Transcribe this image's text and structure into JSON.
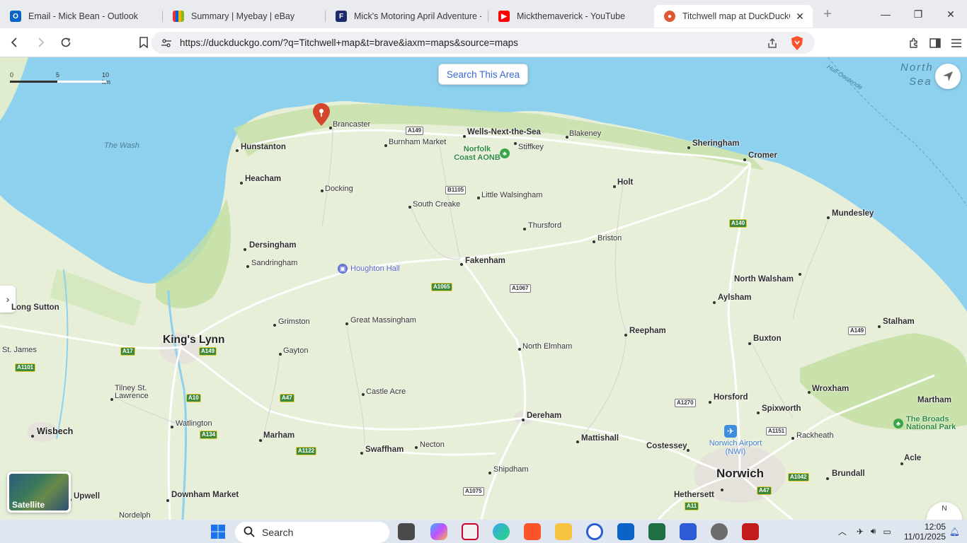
{
  "browser": {
    "tabs": [
      {
        "title": "Email - Mick Bean - Outlook",
        "icon": "outlook-icon",
        "color": "#0a64c8"
      },
      {
        "title": "Summary | Myebay | eBay",
        "icon": "ebay-icon",
        "color": "#e53238"
      },
      {
        "title": "Mick's Motoring April Adventure - ",
        "icon": "fc-icon",
        "color": "#1d2a6b"
      },
      {
        "title": "Mickthemaverick - YouTube",
        "icon": "youtube-icon",
        "color": "#ff0000"
      },
      {
        "title": "Titchwell map at DuckDuckGo",
        "icon": "duckduckgo-icon",
        "color": "#de5833",
        "active": true
      }
    ],
    "new_tab_label": "+",
    "url": "https://duckduckgo.com/?q=Titchwell+map&t=brave&iaxm=maps&source=maps"
  },
  "map": {
    "search_this_area": "Search This Area",
    "scale": {
      "zero": "0",
      "mid": "5",
      "end": "10 km"
    },
    "satellite_label": "Satellite",
    "compass_label": "N",
    "sea_labels": [
      {
        "text": "The Wash"
      },
      {
        "text": "North"
      },
      {
        "text": "Sea"
      },
      {
        "text": "Hull-Oostende"
      }
    ],
    "places": [
      {
        "text": "Brancaster",
        "size": "sm"
      },
      {
        "text": "Hunstanton",
        "size": "med"
      },
      {
        "text": "Burnham Market",
        "size": "sm"
      },
      {
        "text": "Wells-Next-the-Sea",
        "size": "med"
      },
      {
        "text": "Blakeney",
        "size": "sm"
      },
      {
        "text": "Stiffkey",
        "size": "sm"
      },
      {
        "text": "Sheringham",
        "size": "med"
      },
      {
        "text": "Cromer",
        "size": "med"
      },
      {
        "text": "Heacham",
        "size": "med"
      },
      {
        "text": "Docking",
        "size": "sm"
      },
      {
        "text": "Little Walsingham",
        "size": "sm"
      },
      {
        "text": "South Creake",
        "size": "sm"
      },
      {
        "text": "Holt",
        "size": "med"
      },
      {
        "text": "Mundesley",
        "size": "med"
      },
      {
        "text": "Thursford",
        "size": "sm"
      },
      {
        "text": "Briston",
        "size": "sm"
      },
      {
        "text": "Dersingham",
        "size": "med"
      },
      {
        "text": "Sandringham",
        "size": "sm"
      },
      {
        "text": "Fakenham",
        "size": "med"
      },
      {
        "text": "North Walsham",
        "size": "med"
      },
      {
        "text": "Aylsham",
        "size": "med"
      },
      {
        "text": "Long Sutton",
        "size": "med"
      },
      {
        "text": "Grimston",
        "size": "sm"
      },
      {
        "text": "Great Massingham",
        "size": "sm"
      },
      {
        "text": "Reepham",
        "size": "med"
      },
      {
        "text": "Stalham",
        "size": "med"
      },
      {
        "text": "King's Lynn",
        "size": "xl"
      },
      {
        "text": "St. James",
        "size": "sm"
      },
      {
        "text": "Gayton",
        "size": "sm"
      },
      {
        "text": "North Elmham",
        "size": "sm"
      },
      {
        "text": "Buxton",
        "size": "med"
      },
      {
        "text": "Tilney St. Lawrence",
        "size": "sm"
      },
      {
        "text": "Castle Acre",
        "size": "sm"
      },
      {
        "text": "Horsford",
        "size": "med"
      },
      {
        "text": "Wroxham",
        "size": "med"
      },
      {
        "text": "Martham",
        "size": "med"
      },
      {
        "text": "Spixworth",
        "size": "med"
      },
      {
        "text": "Dereham",
        "size": "med"
      },
      {
        "text": "Wisbech",
        "size": "big"
      },
      {
        "text": "Watlington",
        "size": "sm"
      },
      {
        "text": "Marham",
        "size": "med"
      },
      {
        "text": "Mattishall",
        "size": "med"
      },
      {
        "text": "Costessey",
        "size": "med"
      },
      {
        "text": "Rackheath",
        "size": "sm"
      },
      {
        "text": "Swaffham",
        "size": "med"
      },
      {
        "text": "Necton",
        "size": "sm"
      },
      {
        "text": "Acle",
        "size": "med"
      },
      {
        "text": "Shipdham",
        "size": "sm"
      },
      {
        "text": "Norwich",
        "size": "xl"
      },
      {
        "text": "Brundall",
        "size": "med"
      },
      {
        "text": "Hethersett",
        "size": "med"
      },
      {
        "text": "Upwell",
        "size": "med"
      },
      {
        "text": "Downham Market",
        "size": "med"
      },
      {
        "text": "Nordelph",
        "size": "sm"
      }
    ],
    "pois": [
      {
        "text": "Norfolk Coast AONB",
        "type": "green"
      },
      {
        "text": "Houghton Hall",
        "type": "poi"
      },
      {
        "text": "Norwich Airport (NWI)",
        "type": "airport"
      },
      {
        "text": "The Broads National Park",
        "type": "green"
      }
    ],
    "roads": [
      "A149",
      "B1105",
      "A1065",
      "A1067",
      "A140",
      "A149",
      "A17",
      "A149",
      "A1101",
      "A10",
      "A47",
      "A134",
      "A1122",
      "A1075",
      "A1270",
      "A1151",
      "A1042",
      "A47",
      "A11"
    ]
  },
  "taskbar": {
    "search_placeholder": "Search",
    "time": "12:05",
    "date": "11/01/2025"
  }
}
